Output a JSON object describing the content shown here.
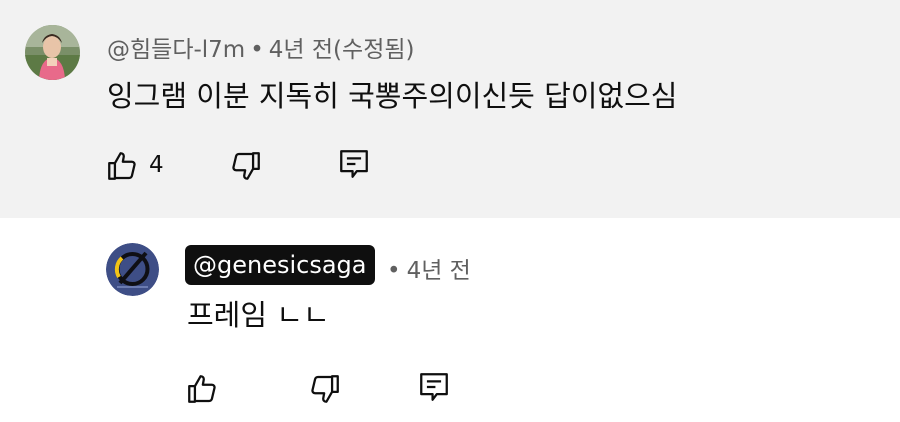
{
  "top_comment": {
    "author": "@힘들다-l7m",
    "separator": "•",
    "time": "4년 전(수정됨)",
    "text": "잉그램 이분 지독히 국뽕주의이신듯 답이없으심",
    "like_count": "4",
    "icons": {
      "avatar": "profile-photo-avatar",
      "like": "thumbs-up-icon",
      "dislike": "thumbs-down-icon",
      "reply": "reply-comment-icon"
    }
  },
  "reply": {
    "author": "@genesicsaga",
    "separator": "•",
    "time": "4년 전",
    "text": "프레임 ㄴㄴ",
    "icons": {
      "avatar": "channel-logo-avatar",
      "like": "thumbs-up-icon",
      "dislike": "thumbs-down-icon",
      "reply": "reply-comment-icon"
    }
  },
  "colors": {
    "top_background": "#f2f2f2",
    "meta_text": "#606060",
    "badge_background": "#0f0f0f",
    "logo_blue": "#3e4e86",
    "logo_yellow": "#f2c417"
  }
}
